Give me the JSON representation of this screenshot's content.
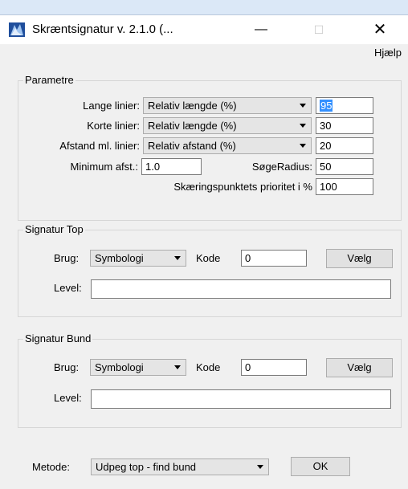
{
  "window": {
    "title": "Skræntsignatur v.  2.1.0 (...",
    "minimize_glyph": "—",
    "maximize_glyph": "☐",
    "close_glyph": "✕",
    "icon": "app-icon"
  },
  "menu": {
    "help_label": "Hjælp"
  },
  "parametre": {
    "legend": "Parametre",
    "lange_label": "Lange linier:",
    "lange_mode": "Relativ længde (%)",
    "lange_value": "95",
    "korte_label": "Korte linier:",
    "korte_mode": "Relativ længde (%)",
    "korte_value": "30",
    "afstand_label": "Afstand ml. linier:",
    "afstand_mode": "Relativ afstand (%)",
    "afstand_value": "20",
    "min_afst_label": "Minimum afst.:",
    "min_afst_value": "1.0",
    "soege_label": "SøgeRadius:",
    "soege_value": "50",
    "prioritet_label": "Skæringspunktets prioritet i %",
    "prioritet_value": "100"
  },
  "signatur_top": {
    "legend": "Signatur Top",
    "brug_label": "Brug:",
    "brug_value": "Symbologi",
    "kode_label": "Kode",
    "kode_value": "0",
    "vaelg_label": "Vælg",
    "level_label": "Level:",
    "level_value": ""
  },
  "signatur_bund": {
    "legend": "Signatur Bund",
    "brug_label": "Brug:",
    "brug_value": "Symbologi",
    "kode_label": "Kode",
    "kode_value": "0",
    "vaelg_label": "Vælg",
    "level_label": "Level:",
    "level_value": ""
  },
  "footer": {
    "metode_label": "Metode:",
    "metode_value": "Udpeg top - find bund",
    "ok_label": "OK"
  }
}
